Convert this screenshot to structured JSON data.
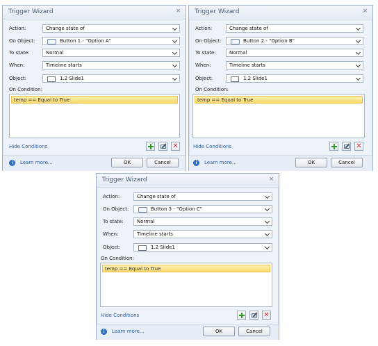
{
  "common": {
    "title": "Trigger Wizard",
    "close_glyph": "×",
    "labels": {
      "action": "Action:",
      "on_object": "On Object:",
      "to_state": "To state:",
      "when": "When:",
      "object": "Object:",
      "on_condition": "On Condition:"
    },
    "hide_conditions": "Hide Conditions",
    "learn_more": "Learn more...",
    "ok": "OK",
    "cancel": "Cancel",
    "info_glyph": "i",
    "delete_glyph": "✕",
    "icons": [
      "close-icon",
      "chevron-down-icon",
      "button-object-icon",
      "slide-icon",
      "add-icon",
      "edit-icon",
      "delete-icon",
      "info-icon"
    ],
    "colors": {
      "condition_highlight": "#f6d66a",
      "link": "#2a5ea8",
      "add": "#2f9a2a",
      "delete": "#d22a2a"
    }
  },
  "dialogs": [
    {
      "action": "Change state of",
      "on_object": "Button 1 - \"Option A\"",
      "to_state": "Normal",
      "when": "Timeline starts",
      "object": "1.2 Slide1",
      "condition": "temp == Equal to True"
    },
    {
      "action": "Change state of",
      "on_object": "Button 2 - \"Option B\"",
      "to_state": "Normal",
      "when": "Timeline starts",
      "object": "1.2 Slide1",
      "condition": "temp == Equal to True"
    },
    {
      "action": "Change state of",
      "on_object": "Button 3 - \"Option C\"",
      "to_state": "Normal",
      "when": "Timeline starts",
      "object": "1.2 Slide1",
      "condition": "temp == Equal to True"
    }
  ]
}
